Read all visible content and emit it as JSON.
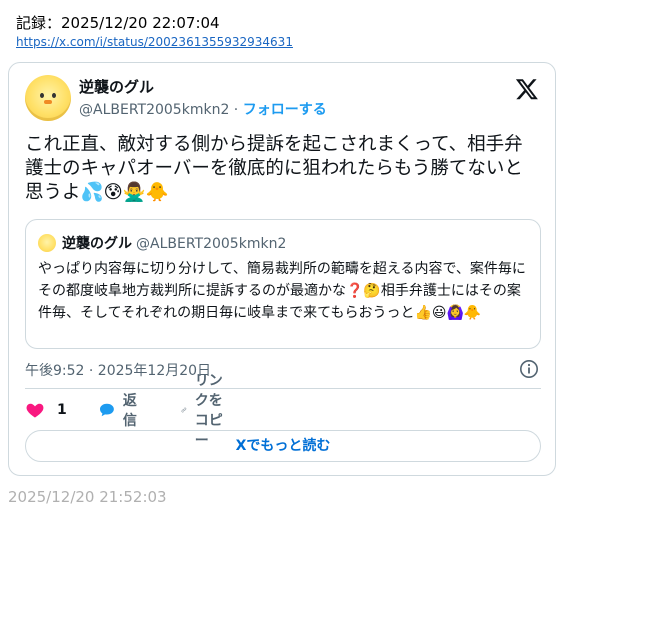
{
  "record": {
    "label": "記録：2025/12/20 22:07:04",
    "url": "https://x.com/i/status/2002361355932934631"
  },
  "tweet": {
    "display_name": "逆襲のグル",
    "handle": "@ALBERT2005kmkn2",
    "separator": " · ",
    "follow_label": "フォローする",
    "text": "これ正直、敵対する側から提訴を起こされまくって、相手弁護士のキャパオーバーを徹底的に狙われたらもう勝てないと思うよ💦😰🙅‍♂️🐥",
    "quote": {
      "display_name": "逆襲のグル",
      "handle": "@ALBERT2005kmkn2",
      "text": "やっぱり内容毎に切り分けして、簡易裁判所の範疇を超える内容で、案件毎にその都度岐阜地方裁判所に提訴するのが最適かな❓🤔相手弁護士にはその案件毎、そしてそれぞれの期日毎に岐阜まで来てもらおうっと👍😃🙆‍♀️🐥"
    },
    "timestamp": "午後9:52 · 2025年12月20日",
    "likes": "1",
    "reply_label": "返信",
    "copy_link_label": "リンクをコピー",
    "read_more_label": "Xでもっと読む"
  },
  "footer_time": "2025/12/20 21:52:03",
  "icons": {
    "logo": "x-logo-icon",
    "like": "heart-icon",
    "reply": "speech-bubble-icon",
    "link": "link-icon",
    "info": "info-icon"
  },
  "colors": {
    "link": "#1a66c2",
    "accent": "#1d9bf0",
    "like": "#f91880",
    "muted": "#536471",
    "border": "#cfd9de"
  }
}
